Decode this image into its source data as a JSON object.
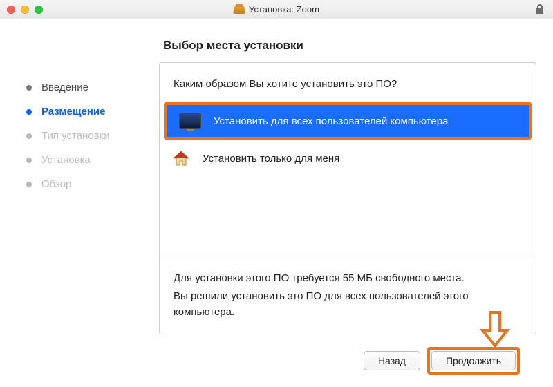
{
  "titlebar": {
    "title": "Установка: Zoom"
  },
  "sidebar": {
    "steps": [
      {
        "label": "Введение",
        "state": "done"
      },
      {
        "label": "Размещение",
        "state": "current"
      },
      {
        "label": "Тип установки",
        "state": "future"
      },
      {
        "label": "Установка",
        "state": "future"
      },
      {
        "label": "Обзор",
        "state": "future"
      }
    ]
  },
  "main": {
    "heading": "Выбор места установки",
    "question": "Каким образом Вы хотите установить это ПО?",
    "options": {
      "all_users": "Установить для всех пользователей компьютера",
      "me_only": "Установить только для меня"
    },
    "info_line1": "Для установки этого ПО требуется 55 МБ свободного места.",
    "info_line2": "Вы решили установить это ПО для всех пользователей этого компьютера."
  },
  "footer": {
    "back": "Назад",
    "continue": "Продолжить"
  },
  "colors": {
    "accent_blue": "#1a6dff",
    "highlight_orange": "#e9731f"
  }
}
